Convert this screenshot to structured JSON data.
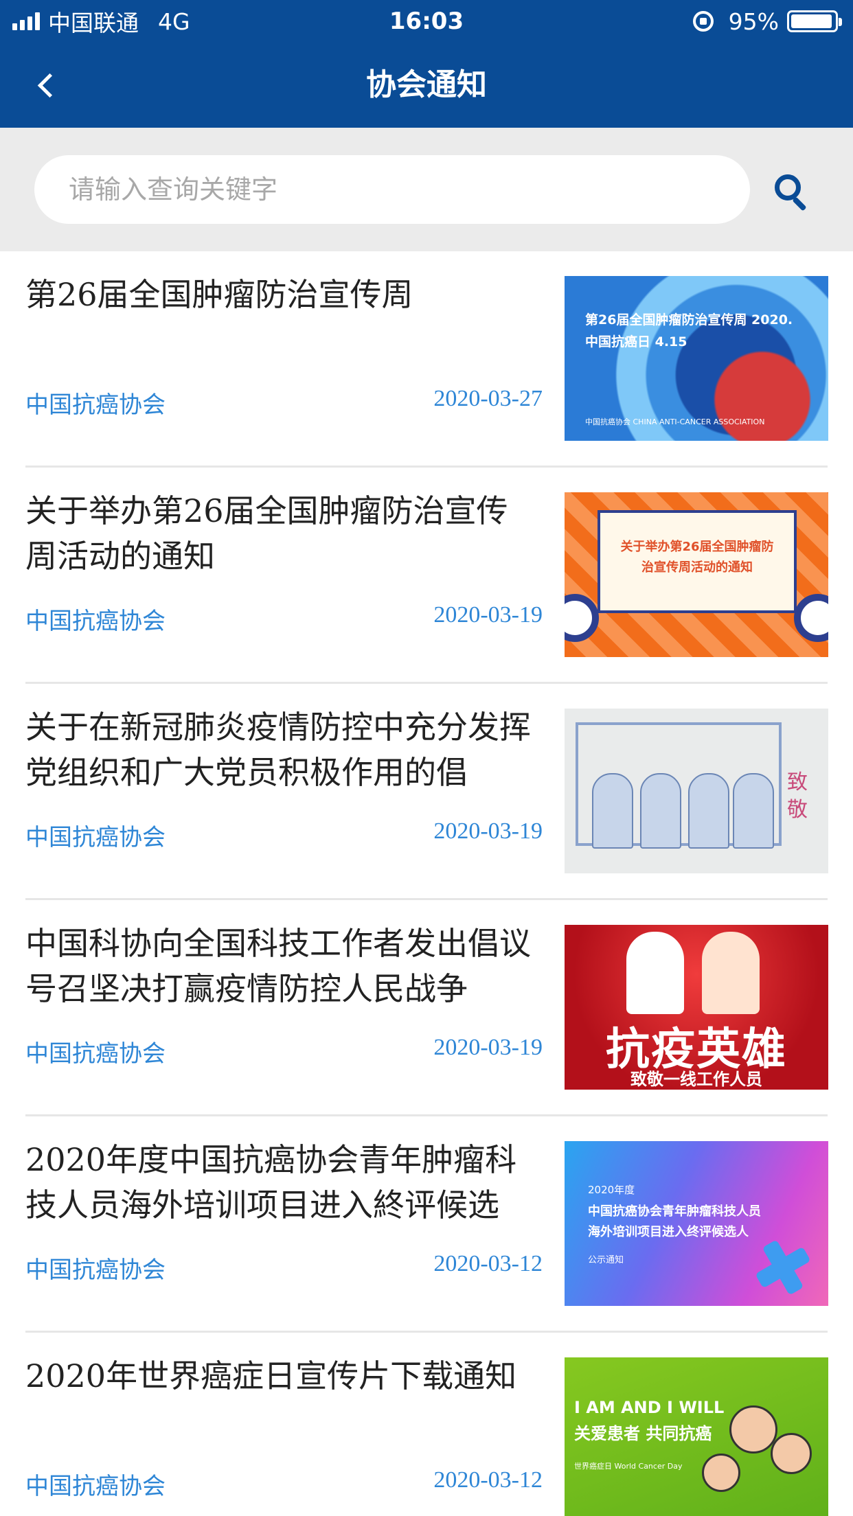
{
  "status_bar": {
    "carrier": "中国联通",
    "network": "4G",
    "time": "16:03",
    "battery": "95%",
    "battery_level": 0.95
  },
  "nav": {
    "title": "协会通知"
  },
  "search": {
    "placeholder": "请输入查询关键字"
  },
  "notices": [
    {
      "title": "第26届全国肿瘤防治宣传周",
      "source": "中国抗癌协会",
      "date": "2020-03-27",
      "thumb_caption": [
        "第26届全国肿瘤防治宣传周  2020.",
        "中国抗癌日 4.15"
      ],
      "thumb_logo": "中国抗癌协会 CHINA ANTI-CANCER ASSOCIATION"
    },
    {
      "title": "关于举办第26届全国肿瘤防治宣传周活动的通知",
      "source": "中国抗癌协会",
      "date": "2020-03-19",
      "thumb_caption": [
        "关于举办第26届全国肿瘤防",
        "治宣传周活动的通知"
      ]
    },
    {
      "title": "关于在新冠肺炎疫情防控中充分发挥党组织和广大党员积极作用的倡",
      "source": "中国抗癌协会",
      "date": "2020-03-19",
      "thumb_caption": [
        "致敬"
      ]
    },
    {
      "title": "中国科协向全国科技工作者发出倡议 号召坚决打赢疫情防控人民战争",
      "source": "中国抗癌协会",
      "date": "2020-03-19",
      "thumb_caption": [
        "抗疫英雄",
        "致敬一线工作人员"
      ]
    },
    {
      "title": "2020年度中国抗癌协会青年肿瘤科技人员海外培训项目进入終评候选",
      "source": "中国抗癌协会",
      "date": "2020-03-12",
      "thumb_caption": [
        "2020年度",
        "中国抗癌协会青年肿瘤科技人员",
        "海外培训项目进入终评候选人",
        "公示通知"
      ]
    },
    {
      "title": "2020年世界癌症日宣传片下载通知",
      "source": "中国抗癌协会",
      "date": "2020-03-12",
      "thumb_caption": [
        "I AM AND I WILL",
        "关爱患者 共同抗癌",
        "世界癌症日 World Cancer Day"
      ]
    }
  ]
}
